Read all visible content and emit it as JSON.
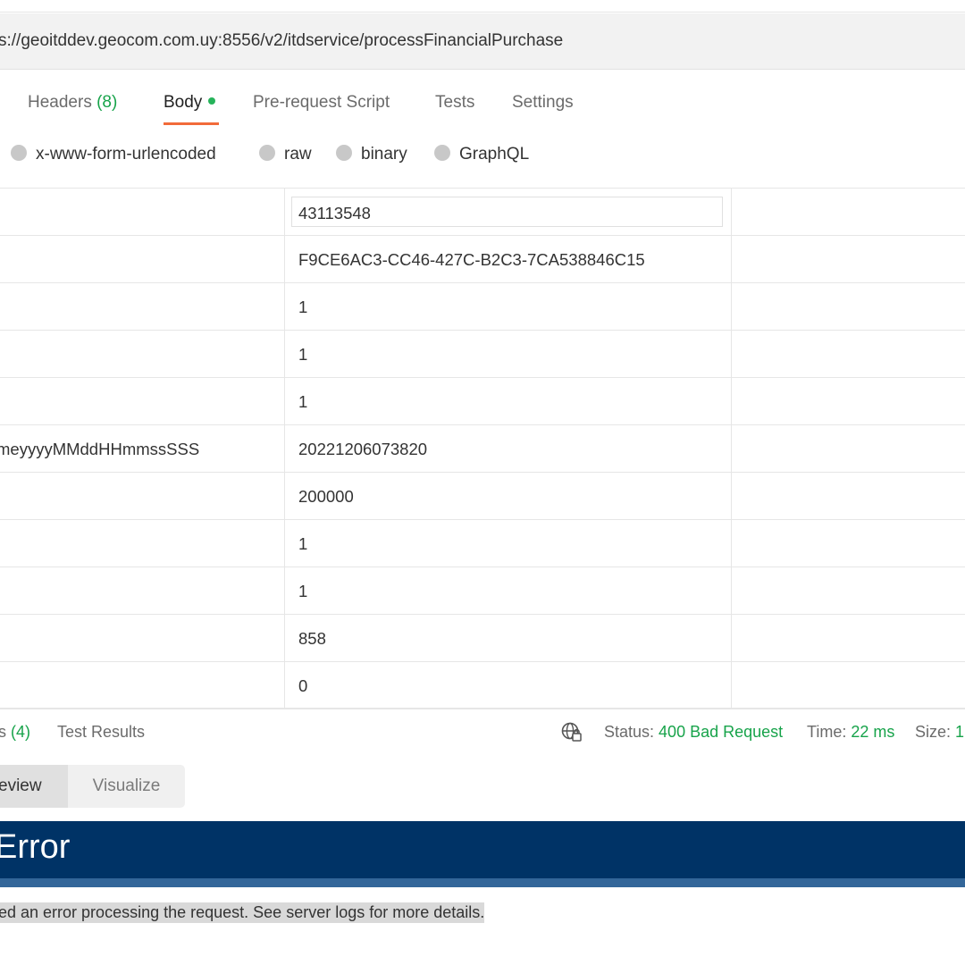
{
  "url": "s://geoitddev.geocom.com.uy:8556/v2/itdservice/processFinancialPurchase",
  "tabs": {
    "headers_label": "Headers",
    "headers_count": "(8)",
    "body": "Body",
    "prerequest": "Pre-request Script",
    "tests": "Tests",
    "settings": "Settings"
  },
  "body_types": [
    "x-www-form-urlencoded",
    "raw",
    "binary",
    "GraphQL"
  ],
  "rows": [
    {
      "key": "",
      "value": "43113548"
    },
    {
      "key": "",
      "value": "F9CE6AC3-CC46-427C-B2C3-7CA538846C15"
    },
    {
      "key": "",
      "value": "1"
    },
    {
      "key": "",
      "value": "1"
    },
    {
      "key": "",
      "value": "1"
    },
    {
      "key": "meyyyyMMddHHmmssSSS",
      "value": "20221206073820"
    },
    {
      "key": "",
      "value": "200000"
    },
    {
      "key": "",
      "value": "1"
    },
    {
      "key": "",
      "value": "1"
    },
    {
      "key": "",
      "value": "858"
    },
    {
      "key": "",
      "value": "0"
    }
  ],
  "response": {
    "headers_tab_suffix": "s",
    "headers_tab_count": "(4)",
    "test_results": "Test Results",
    "status_label": "Status:",
    "status_value": "400 Bad Request",
    "time_label": "Time:",
    "time_value": "22 ms",
    "size_label": "Size:",
    "size_value": "1."
  },
  "view_tabs": {
    "preview": "eview",
    "visualize": "Visualize"
  },
  "error": {
    "title": "Error",
    "message": "ed an error processing the request. See server logs for more details."
  },
  "colors": {
    "accent_green": "#17a34a",
    "tab_underline": "#f26b3a",
    "error_banner": "#003366",
    "error_stripe": "#336699"
  }
}
